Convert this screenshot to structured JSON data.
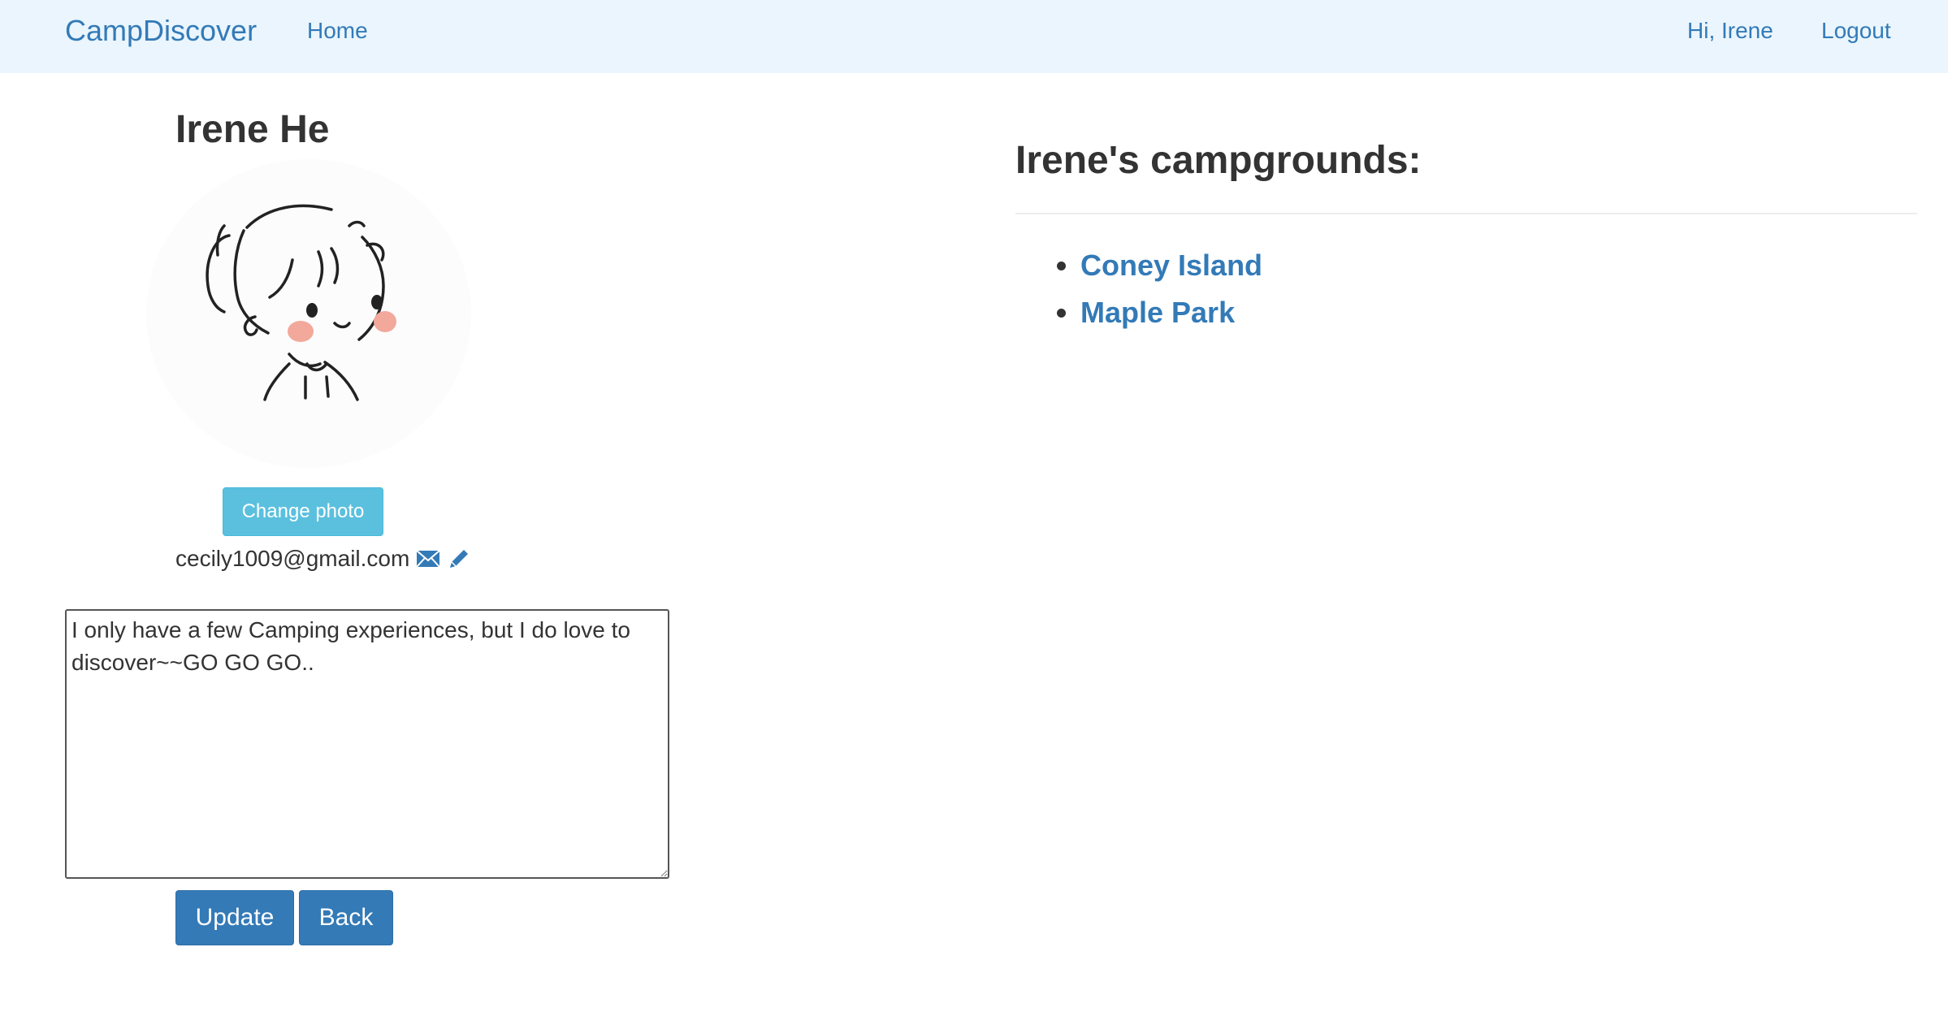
{
  "navbar": {
    "brand": "CampDiscover",
    "home": "Home",
    "greeting": "Hi, Irene",
    "logout": "Logout"
  },
  "profile": {
    "name": "Irene He",
    "change_photo_label": "Change photo",
    "email": "cecily1009@gmail.com",
    "email_icon": "envelope-icon",
    "edit_icon": "pencil-icon",
    "bio": "I only have a few Camping experiences, but I do love to discover~~GO GO GO..",
    "update_label": "Update",
    "back_label": "Back"
  },
  "campgrounds": {
    "heading": "Irene's campgrounds:",
    "items": [
      {
        "label": "Coney Island"
      },
      {
        "label": "Maple Park"
      }
    ]
  },
  "colors": {
    "link": "#337ab7",
    "navbar_bg": "#eaf5fd",
    "info_button": "#5bc0de",
    "primary_button": "#337ab7",
    "blush": "#f2a89a"
  }
}
